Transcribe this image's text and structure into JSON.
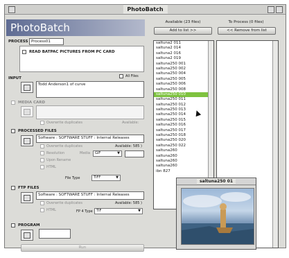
{
  "window": {
    "title": "PhotoBatch"
  },
  "brand": {
    "name": "PhotoBatch"
  },
  "process": {
    "label": "PROCESS",
    "value": "Process01"
  },
  "read_card": {
    "label": "READ BATPAC PICTURES FROM PC CARD"
  },
  "input": {
    "label": "INPUT",
    "all_files_label": "All Files",
    "value": "Todd Anderson1 of curve"
  },
  "media_card": {
    "label": "MEDIA CARD",
    "overwrite_label": "Overwrite duplicates",
    "available": "Available:"
  },
  "processed": {
    "label": "PROCESSED FILES",
    "path": "Software : SOFTWARE STUFF : Internal Releases",
    "overwrite_label": "Overwrite duplicates",
    "available": "Available: 585 )",
    "resolution_label": "Resolution",
    "media_label": "Media",
    "media_value": "GIF",
    "upon_rename_label": "Upon Rename",
    "html_label": "HTML",
    "file_type_label": "File Type",
    "file_type_value": "TIFF"
  },
  "ftp": {
    "label": "FTP FILES",
    "path": "Software : SOFTWARE STUFF : Internal Releases",
    "overwrite_label": "Overwrite duplicates",
    "available": "Available: 585 )",
    "html_label": "HTML",
    "file_type_label": "FP 4 Type",
    "file_type_value": "TIF"
  },
  "program": {
    "label": "PROGRAM"
  },
  "run_button": {
    "label": "Run"
  },
  "available_panel": {
    "header": "Available (23 files)",
    "button": "Add to list >>",
    "items": [
      "saltuna2 011",
      "saltuna2 014",
      "saltuna2 016",
      "saltuna2 019",
      "saltuna250 001",
      "saltuna250 002",
      "saltuna250 004",
      "saltuna250 005",
      "saltuna250 006",
      "saltuna250 008",
      "saltuna250 010",
      "saltuna250 011",
      "saltuna250 012",
      "saltuna250 013",
      "saltuna250 014",
      "saltuna250 015",
      "saltuna250 016",
      "saltuna250 017",
      "saltuna250 018",
      "saltuna250 020",
      "saltuna250 022",
      "saltuna260",
      "saltuna260",
      "saltuna260",
      "saltuna260",
      "ibn 827"
    ],
    "selected_index": 10
  },
  "to_process_panel": {
    "header": "To Process (0 files)",
    "button": "<< Remove from list"
  },
  "preview": {
    "title": "saltuna250 01"
  }
}
